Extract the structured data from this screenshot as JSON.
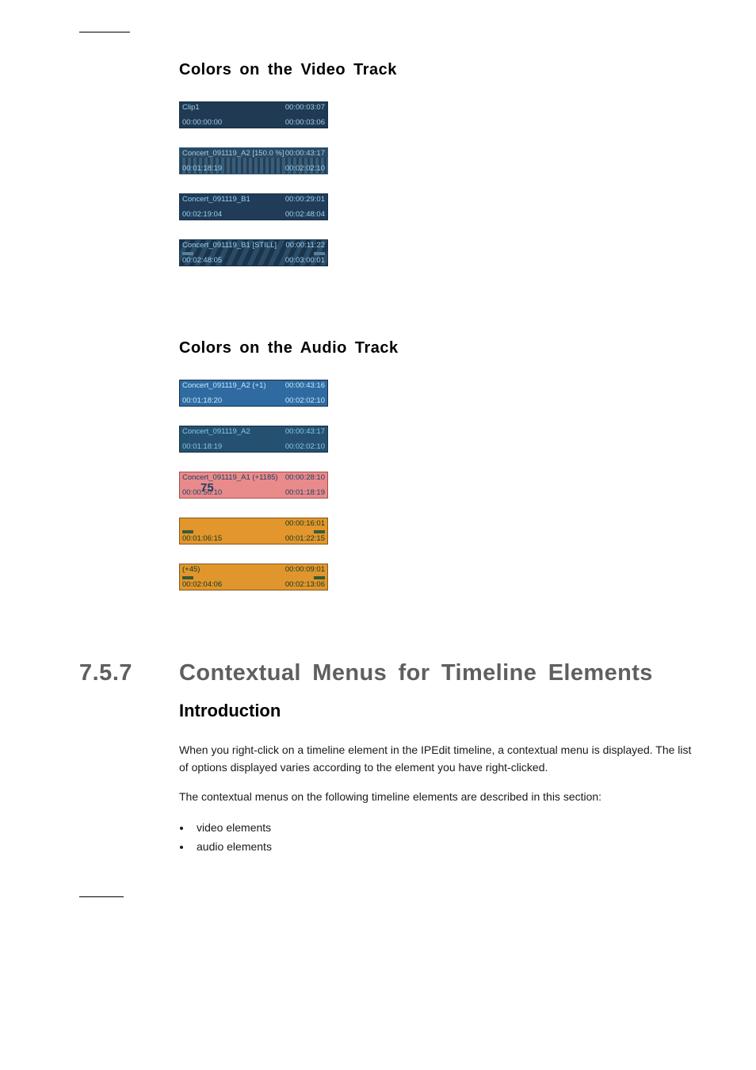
{
  "section": {
    "video_track_heading": "Colors on the Video Track",
    "audio_track_heading": "Colors on the Audio Track",
    "number": "7.5.7",
    "title": "Contextual Menus for Timeline Elements",
    "intro_heading": "Introduction",
    "intro_p1": "When you right-click on a timeline element in the IPEdit timeline, a contextual menu is displayed. The list of options displayed varies according to the element you have right-clicked.",
    "intro_p2": "The contextual menus on the following timeline elements are described in this section:",
    "bullets": [
      "video elements",
      "audio elements"
    ]
  },
  "video_clips": [
    {
      "tl": "Clip1",
      "tr": "00:00:03:07",
      "bl": "00:00:00:00",
      "br": "00:00:03:06"
    },
    {
      "tl": "Concert_091119_A2 [150.0 %]",
      "tr": "00:00:43:17",
      "bl": "00:01:18:19",
      "br": "00:02:02:10"
    },
    {
      "tl": "Concert_091119_B1",
      "tr": "00:00:29:01",
      "bl": "00:02:19:04",
      "br": "00:02:48:04"
    },
    {
      "tl": "Concert_091119_B1 [STILL]",
      "tr": "00:00:11:22",
      "bl": "00:02:48:05",
      "br": "00:03:00:01"
    }
  ],
  "audio_clips": [
    {
      "tl": "Concert_091119_A2 (+1)",
      "tr": "00:00:43:16",
      "bl": "00:01:18:20",
      "br": "00:02:02:10",
      "cl": ""
    },
    {
      "tl": "Concert_091119_A2",
      "tr": "00:00:43:17",
      "bl": "00:01:18:19",
      "br": "00:02:02:10",
      "cl": ""
    },
    {
      "tl": "Concert_091119_A1 (+1185)",
      "tr": "00:00:28:10",
      "bl": "00:00:50:10",
      "br": "00:01:18:19",
      "cl": "75"
    },
    {
      "tl": "",
      "tr": "00:00:16:01",
      "bl": "00:01:06:15",
      "br": "00:01:22:15",
      "cl": ""
    },
    {
      "tl": "(+45)",
      "tr": "00:00:09:01",
      "bl": "00:02:04:06",
      "br": "00:02:13:06",
      "cl": ""
    }
  ]
}
